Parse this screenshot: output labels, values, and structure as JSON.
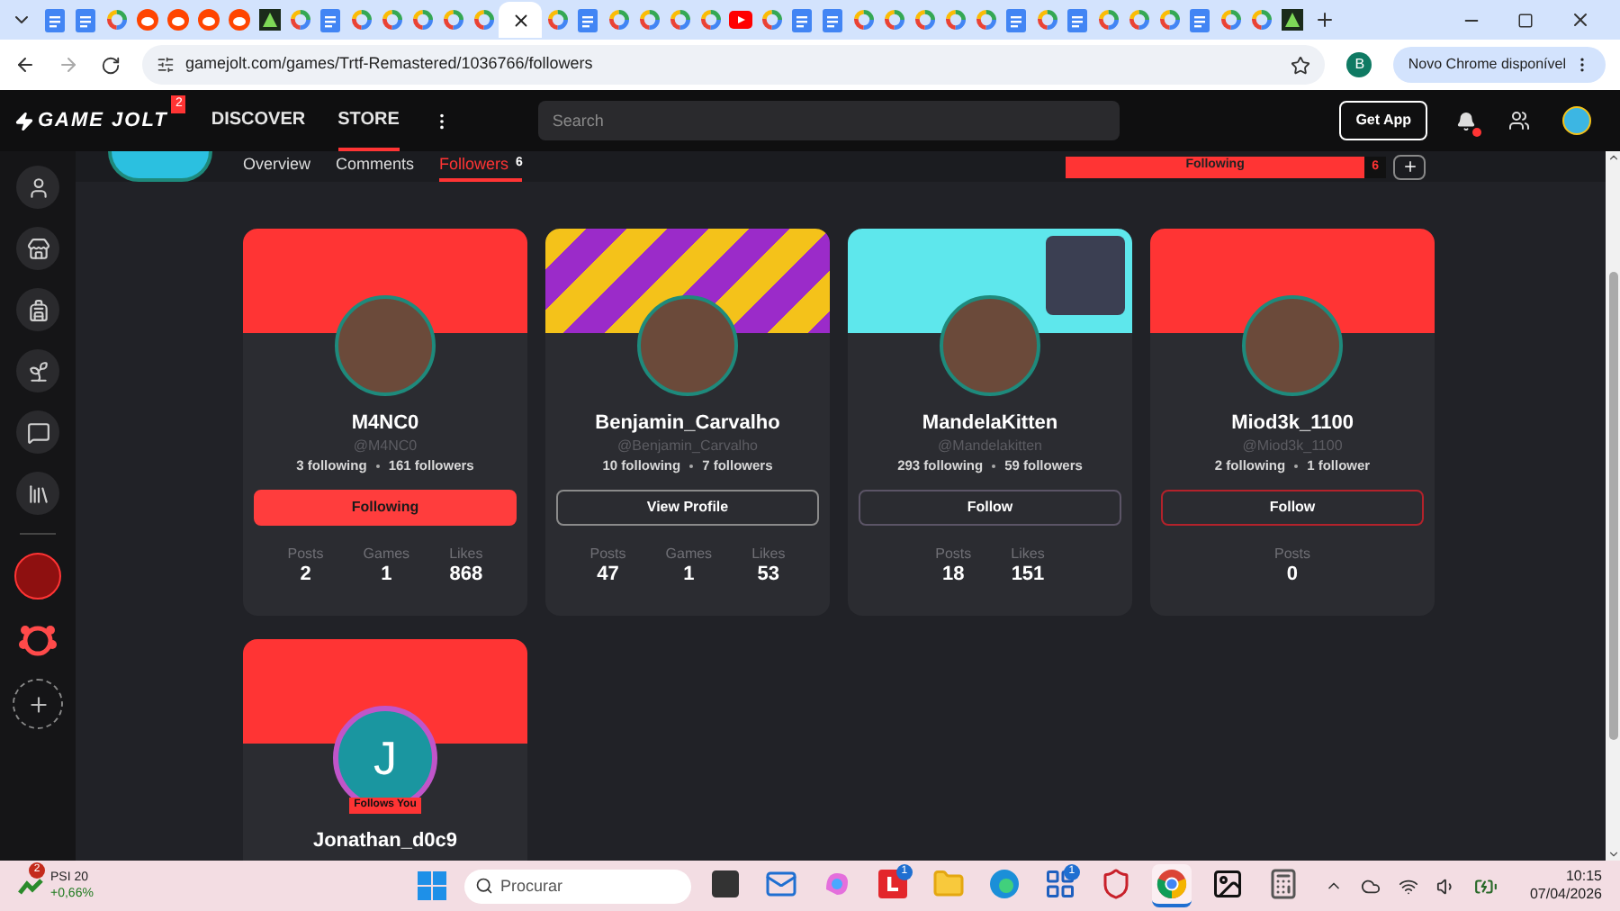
{
  "browser": {
    "tabs": [
      {
        "kind": "docs",
        "selected": false
      },
      {
        "kind": "docs",
        "selected": false
      },
      {
        "kind": "google",
        "selected": false
      },
      {
        "kind": "reddit",
        "selected": false
      },
      {
        "kind": "reddit",
        "selected": false
      },
      {
        "kind": "reddit",
        "selected": false
      },
      {
        "kind": "reddit",
        "selected": false
      },
      {
        "kind": "game",
        "selected": false
      },
      {
        "kind": "google",
        "selected": false
      },
      {
        "kind": "docs",
        "selected": false
      },
      {
        "kind": "google",
        "selected": false
      },
      {
        "kind": "google",
        "selected": false
      },
      {
        "kind": "google",
        "selected": false
      },
      {
        "kind": "google",
        "selected": false
      },
      {
        "kind": "google",
        "selected": false
      },
      {
        "selected": true
      },
      {
        "kind": "google",
        "selected": false
      },
      {
        "kind": "docs",
        "selected": false
      },
      {
        "kind": "google",
        "selected": false
      },
      {
        "kind": "google",
        "selected": false
      },
      {
        "kind": "google",
        "selected": false
      },
      {
        "kind": "google",
        "selected": false
      },
      {
        "kind": "youtube",
        "selected": false
      },
      {
        "kind": "google",
        "selected": false
      },
      {
        "kind": "docs",
        "selected": false
      },
      {
        "kind": "docs",
        "selected": false
      },
      {
        "kind": "google",
        "selected": false
      },
      {
        "kind": "google",
        "selected": false
      },
      {
        "kind": "google",
        "selected": false
      },
      {
        "kind": "google",
        "selected": false
      },
      {
        "kind": "google",
        "selected": false
      },
      {
        "kind": "docs",
        "selected": false
      },
      {
        "kind": "google",
        "selected": false
      },
      {
        "kind": "docs",
        "selected": false
      },
      {
        "kind": "google",
        "selected": false
      },
      {
        "kind": "google",
        "selected": false
      },
      {
        "kind": "google",
        "selected": false
      },
      {
        "kind": "docs",
        "selected": false
      },
      {
        "kind": "google",
        "selected": false
      },
      {
        "kind": "google",
        "selected": false
      },
      {
        "kind": "game",
        "selected": false
      }
    ],
    "url": "gamejolt.com/games/Trtf-Remastered/1036766/followers",
    "profile": "B",
    "update_button": "Novo Chrome disponível"
  },
  "nav": {
    "logo": "GAME JOLT",
    "logo_badge": "2",
    "links": [
      {
        "label": "DISCOVER",
        "selected": false
      },
      {
        "label": "STORE",
        "selected": true
      }
    ],
    "search": {
      "placeholder": "Search"
    },
    "get_app": "Get App"
  },
  "subnav": {
    "tabs": [
      {
        "label": "Overview",
        "selected": false
      },
      {
        "label": "Comments",
        "selected": false
      },
      {
        "label": "Followers",
        "count": "6",
        "selected": true
      }
    ],
    "following_button": {
      "label": "Following",
      "count": "6"
    }
  },
  "cards": [
    {
      "banner": {
        "kind": "red"
      },
      "name": "M4NC0",
      "handle": "@M4NC0",
      "following": "3 following",
      "followers": "161 followers",
      "button": {
        "label": "Following",
        "kind": "following"
      },
      "stats": [
        {
          "label": "Posts",
          "value": "2"
        },
        {
          "label": "Games",
          "value": "1"
        },
        {
          "label": "Likes",
          "value": "868"
        }
      ]
    },
    {
      "banner": {
        "kind": "stripes"
      },
      "name": "Benjamin_Carvalho",
      "handle": "@Benjamin_Carvalho",
      "following": "10 following",
      "followers": "7 followers",
      "button": {
        "label": "View Profile",
        "kind": "view"
      },
      "stats": [
        {
          "label": "Posts",
          "value": "47"
        },
        {
          "label": "Games",
          "value": "1"
        },
        {
          "label": "Likes",
          "value": "53"
        }
      ]
    },
    {
      "banner": {
        "kind": "image"
      },
      "name": "MandelaKitten",
      "handle": "@Mandelakitten",
      "following": "293 following",
      "followers": "59 followers",
      "button": {
        "label": "Follow",
        "kind": "follow"
      },
      "stats": [
        {
          "label": "Posts",
          "value": "18"
        },
        {
          "label": "Likes",
          "value": "151"
        }
      ]
    },
    {
      "banner": {
        "kind": "red"
      },
      "name": "Miod3k_1100",
      "handle": "@Miod3k_1100",
      "following": "2 following",
      "followers": "1 follower",
      "button": {
        "label": "Follow",
        "kind": "follow-red"
      },
      "stats": [
        {
          "label": "Posts",
          "value": "0"
        }
      ]
    },
    {
      "banner": {
        "kind": "red"
      },
      "name": "Jonathan_d0c9",
      "avatar_letter": "J",
      "badge": "Follows You"
    }
  ],
  "taskbar": {
    "widget": {
      "title": "PSI 20",
      "change": "+0,66%",
      "badge": "2"
    },
    "search": {
      "placeholder": "Procurar"
    },
    "apps": [
      {
        "kind": "taskview",
        "selected": false
      },
      {
        "kind": "outlook",
        "selected": false
      },
      {
        "kind": "copilot",
        "selected": false
      },
      {
        "kind": "redapp",
        "badge": "1",
        "selected": false
      },
      {
        "kind": "folder",
        "selected": false
      },
      {
        "kind": "edge",
        "selected": false
      },
      {
        "kind": "store",
        "badge": "1",
        "selected": false
      },
      {
        "kind": "shield",
        "selected": false
      },
      {
        "kind": "chrome",
        "selected": true
      },
      {
        "kind": "photo",
        "selected": false
      },
      {
        "kind": "calculator",
        "selected": false
      }
    ],
    "time": "10:15",
    "date": "07/04/2026"
  }
}
